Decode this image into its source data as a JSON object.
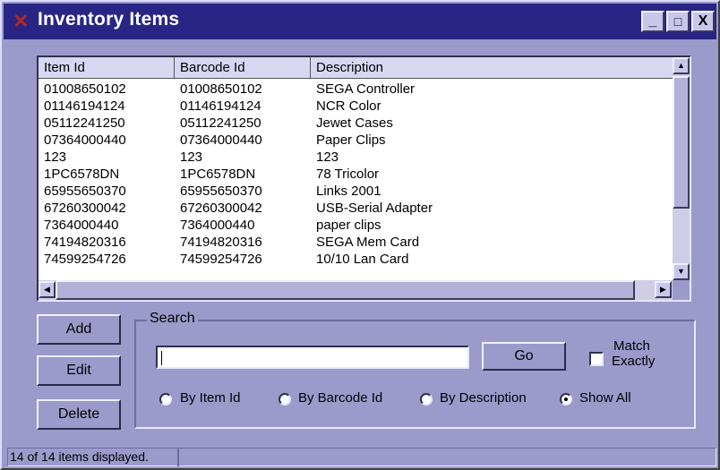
{
  "window": {
    "title": "Inventory Items",
    "icon": "x-app-icon",
    "controls": {
      "minimize": "_",
      "maximize": "□",
      "close": "X"
    }
  },
  "grid": {
    "columns": [
      "Item Id",
      "Barcode Id",
      "Description"
    ],
    "rows": [
      [
        "01008650102",
        "01008650102",
        "SEGA Controller"
      ],
      [
        "01146194124",
        "01146194124",
        "NCR Color"
      ],
      [
        "05112241250",
        "05112241250",
        "Jewet Cases"
      ],
      [
        "07364000440",
        "07364000440",
        "Paper Clips"
      ],
      [
        "123",
        "123",
        "123"
      ],
      [
        "1PC6578DN",
        "1PC6578DN",
        "78 Tricolor"
      ],
      [
        "65955650370",
        "65955650370",
        "Links  2001"
      ],
      [
        "67260300042",
        "67260300042",
        "USB-Serial Adapter"
      ],
      [
        "7364000440",
        "7364000440",
        "paper clips"
      ],
      [
        "74194820316",
        "74194820316",
        "SEGA Mem Card"
      ],
      [
        "74599254726",
        "74599254726",
        "10/10 Lan Card"
      ]
    ]
  },
  "buttons": {
    "add": "Add",
    "edit": "Edit",
    "delete": "Delete",
    "go": "Go"
  },
  "search": {
    "group_label": "Search",
    "value": "",
    "match_exactly": {
      "label_line1": "Match",
      "label_line2": "Exactly",
      "checked": false
    },
    "options": [
      "By Item Id",
      "By Barcode Id",
      "By Description",
      "Show All"
    ],
    "selected": "Show All"
  },
  "status": {
    "text": "14 of 14 items displayed."
  }
}
